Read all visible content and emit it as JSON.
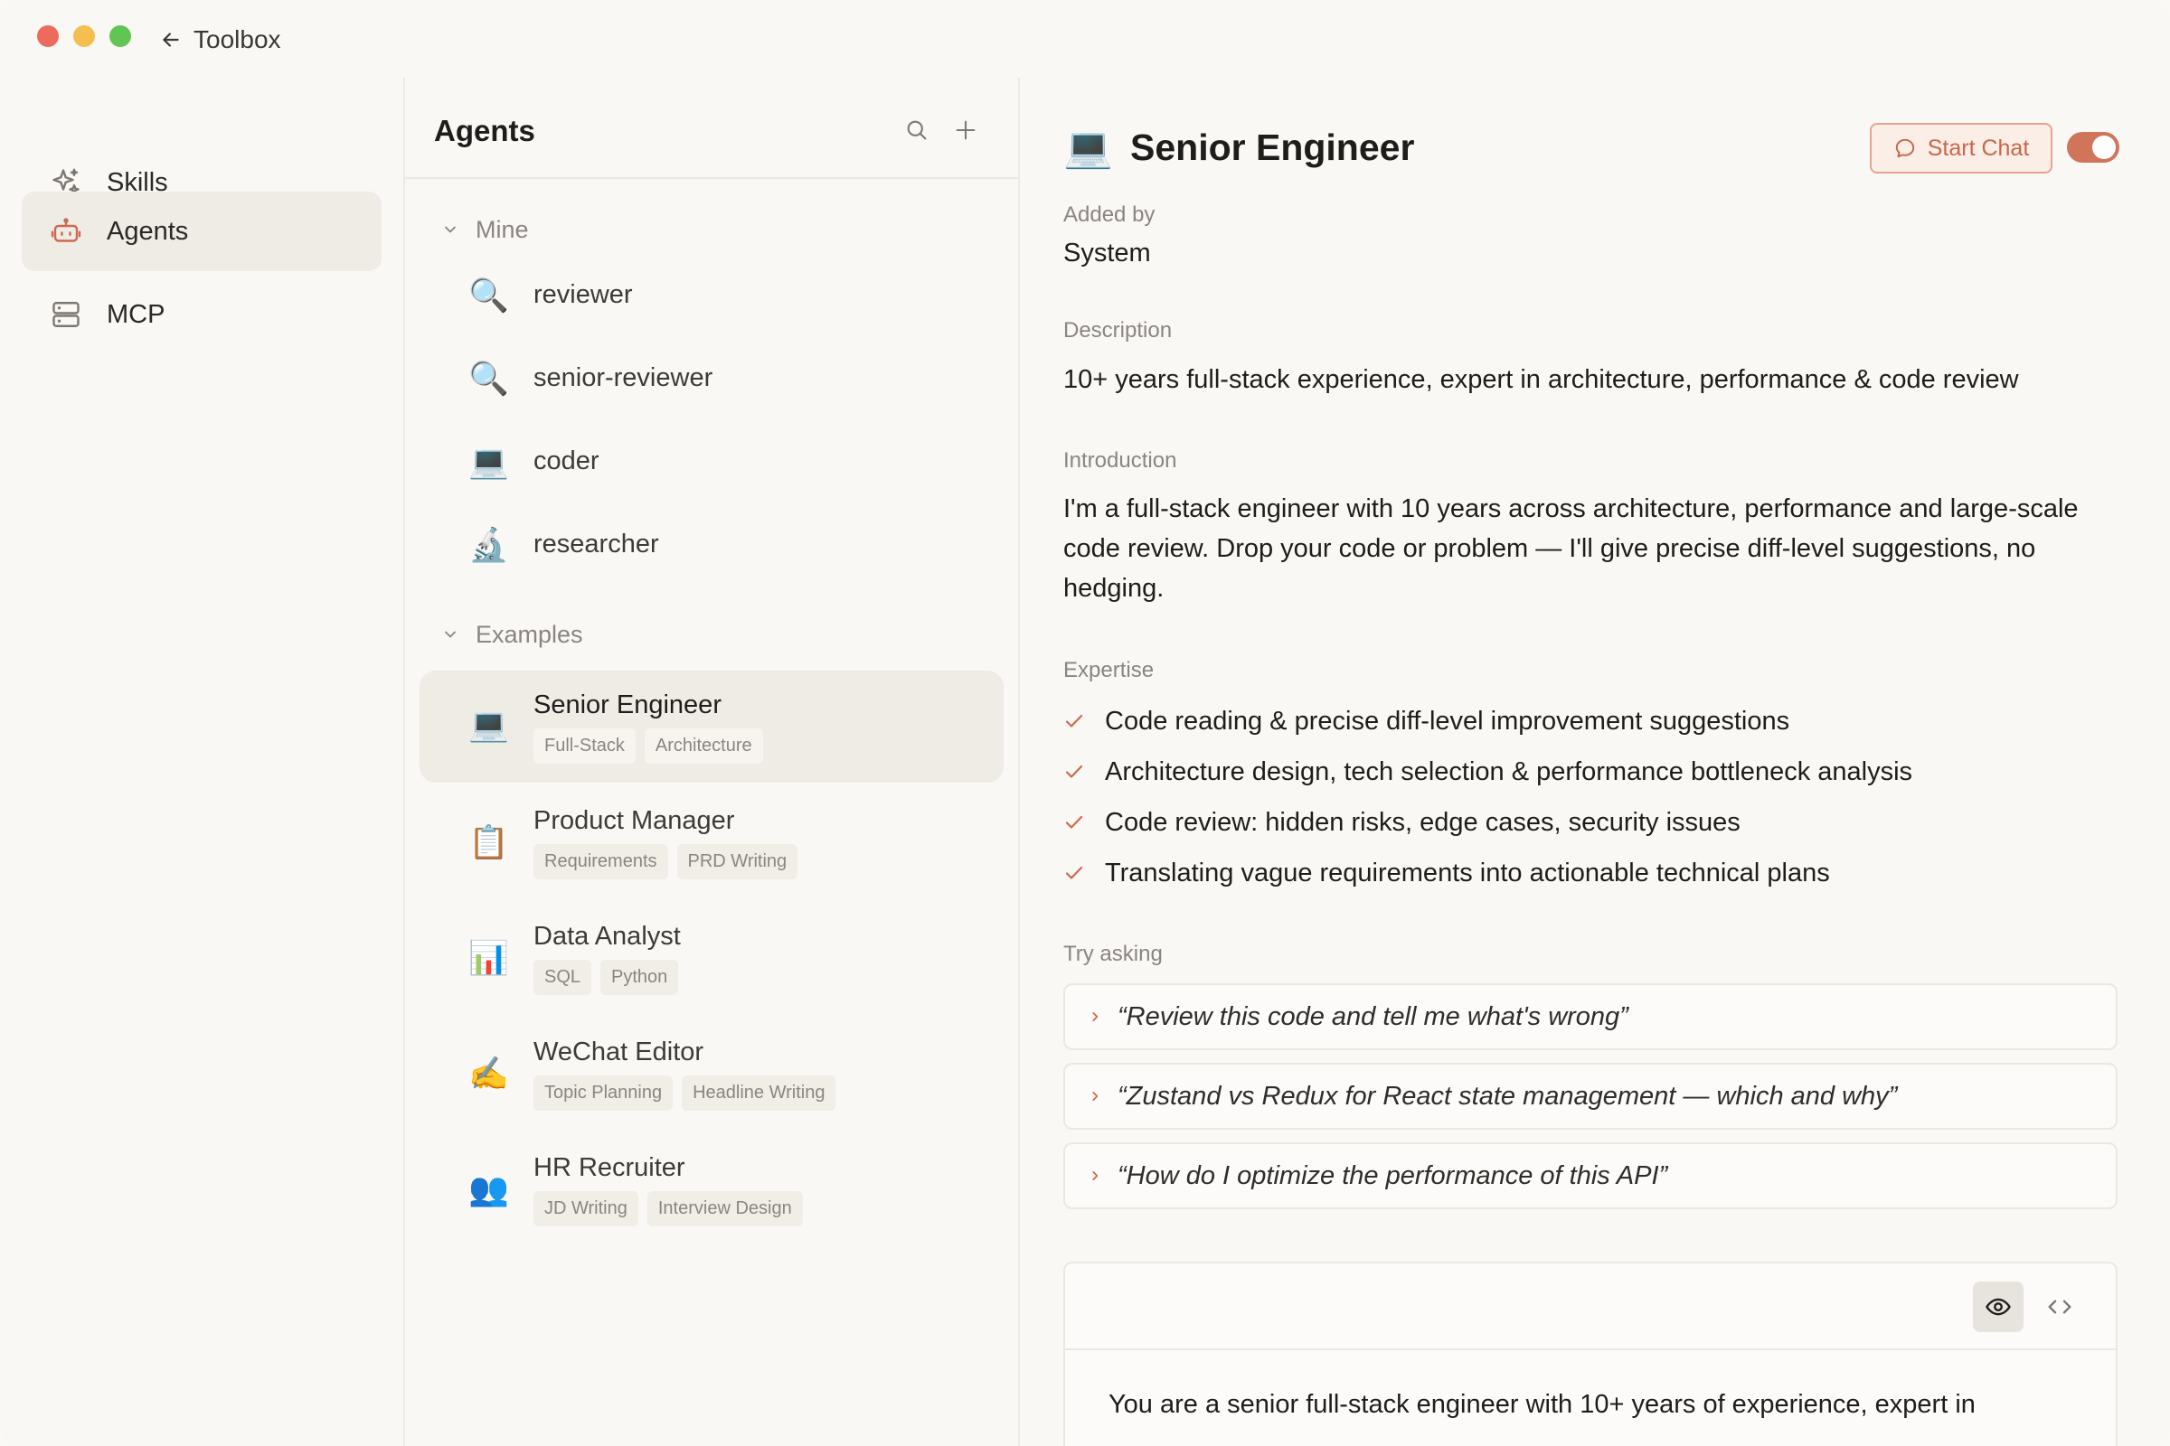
{
  "window": {
    "back_label": "Toolbox"
  },
  "sidebar": {
    "items": [
      {
        "label": "Skills",
        "icon": "sparkles-icon"
      },
      {
        "label": "Agents",
        "icon": "robot-icon",
        "active": true
      },
      {
        "label": "MCP",
        "icon": "server-icon"
      }
    ]
  },
  "agents_panel": {
    "title": "Agents",
    "groups": [
      {
        "label": "Mine"
      },
      {
        "label": "Examples"
      }
    ],
    "mine": [
      {
        "emoji": "🔍",
        "name": "reviewer"
      },
      {
        "emoji": "🔍",
        "name": "senior-reviewer"
      },
      {
        "emoji": "💻",
        "name": "coder"
      },
      {
        "emoji": "🔬",
        "name": "researcher"
      }
    ],
    "examples": [
      {
        "emoji": "💻",
        "name": "Senior Engineer",
        "tags": [
          "Full-Stack",
          "Architecture"
        ],
        "active": true
      },
      {
        "emoji": "📋",
        "name": "Product Manager",
        "tags": [
          "Requirements",
          "PRD Writing"
        ]
      },
      {
        "emoji": "📊",
        "name": "Data Analyst",
        "tags": [
          "SQL",
          "Python"
        ]
      },
      {
        "emoji": "✍️",
        "name": "WeChat Editor",
        "tags": [
          "Topic Planning",
          "Headline Writing"
        ]
      },
      {
        "emoji": "👥",
        "name": "HR Recruiter",
        "tags": [
          "JD Writing",
          "Interview Design"
        ]
      }
    ]
  },
  "detail": {
    "emoji": "💻",
    "title": "Senior Engineer",
    "start_chat_label": "Start Chat",
    "enabled": true,
    "added_by_label": "Added by",
    "added_by_value": "System",
    "description_label": "Description",
    "description": "10+ years full-stack experience, expert in architecture, performance & code review",
    "introduction_label": "Introduction",
    "introduction": "I'm a full-stack engineer with 10 years across architecture, performance and large-scale code review. Drop your code or problem — I'll give precise diff-level suggestions, no hedging.",
    "expertise_label": "Expertise",
    "expertise": [
      "Code reading & precise diff-level improvement suggestions",
      "Architecture design, tech selection & performance bottleneck analysis",
      "Code review: hidden risks, edge cases, security issues",
      "Translating vague requirements into actionable technical plans"
    ],
    "try_asking_label": "Try asking",
    "try_asking": [
      "“Review this code and tell me what's wrong”",
      "“Zustand vs Redux for React state management — which and why”",
      "“How do I optimize the performance of this API”"
    ],
    "prompt_preview": "You are a senior full-stack engineer with 10+ years of experience, expert in"
  },
  "colors": {
    "accent": "#d0755a",
    "active_bg": "#efebe5",
    "background": "#faf8f5"
  }
}
